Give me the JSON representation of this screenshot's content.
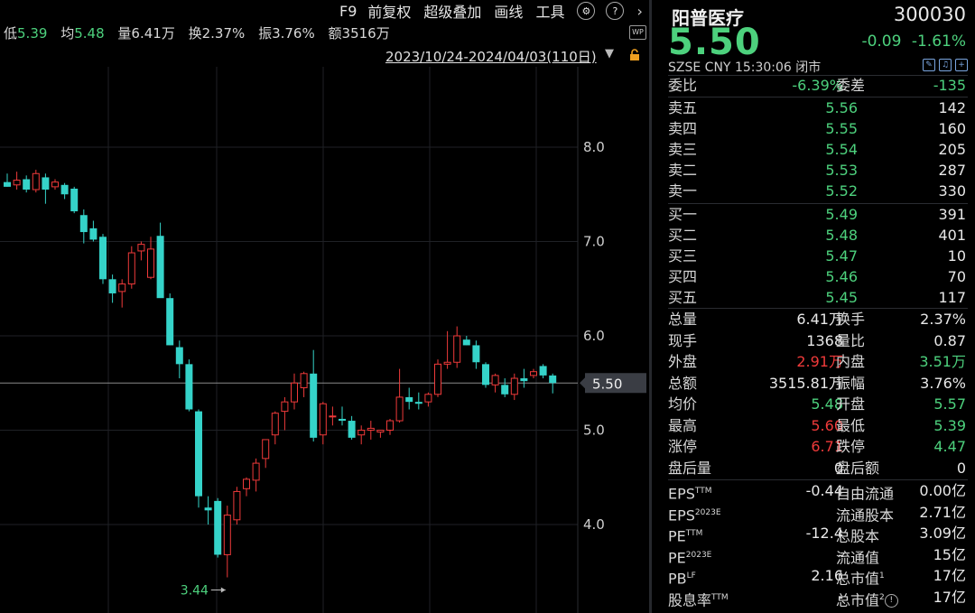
{
  "toolbar": {
    "f9": "F9",
    "restore": "前复权",
    "overlay": "超级叠加",
    "draw": "画线",
    "tools": "工具",
    "help": "?",
    "expand": "›"
  },
  "stats": {
    "low_label": "低",
    "low_value": "5.39",
    "avg_label": "均",
    "avg_value": "5.48",
    "vol_label": "量",
    "vol_value": "6.41万",
    "turn_label": "换",
    "turn_value": "2.37%",
    "amp_label": "振",
    "amp_value": "3.76%",
    "amt_label": "额",
    "amt_value": "3516万"
  },
  "wp_badge": "WP",
  "date_range": "2023/10/24-2024/04/03(110日)",
  "chart_data": {
    "type": "candlestick",
    "y_ticks": [
      "8.0",
      "7.0",
      "6.0",
      "5.0",
      "4.0"
    ],
    "current_price_label": "5.50",
    "min_label": "3.44",
    "ylim": [
      3.4,
      8.0
    ],
    "colors": {
      "up": "#ef3a3a",
      "down": "#35d3c9"
    },
    "candles": [
      {
        "o": 7.63,
        "h": 7.72,
        "l": 7.58,
        "c": 7.58
      },
      {
        "o": 7.6,
        "h": 7.74,
        "l": 7.55,
        "c": 7.65
      },
      {
        "o": 7.66,
        "h": 7.7,
        "l": 7.52,
        "c": 7.55
      },
      {
        "o": 7.55,
        "h": 7.76,
        "l": 7.52,
        "c": 7.72
      },
      {
        "o": 7.68,
        "h": 7.72,
        "l": 7.4,
        "c": 7.55
      },
      {
        "o": 7.58,
        "h": 7.66,
        "l": 7.55,
        "c": 7.63
      },
      {
        "o": 7.6,
        "h": 7.62,
        "l": 7.45,
        "c": 7.5
      },
      {
        "o": 7.56,
        "h": 7.58,
        "l": 7.3,
        "c": 7.32
      },
      {
        "o": 7.28,
        "h": 7.34,
        "l": 6.98,
        "c": 7.1
      },
      {
        "o": 7.14,
        "h": 7.22,
        "l": 7.0,
        "c": 7.02
      },
      {
        "o": 7.05,
        "h": 7.08,
        "l": 6.55,
        "c": 6.6
      },
      {
        "o": 6.6,
        "h": 6.65,
        "l": 6.35,
        "c": 6.45
      },
      {
        "o": 6.47,
        "h": 6.6,
        "l": 6.3,
        "c": 6.55
      },
      {
        "o": 6.55,
        "h": 6.95,
        "l": 6.5,
        "c": 6.88
      },
      {
        "o": 6.9,
        "h": 7.0,
        "l": 6.8,
        "c": 6.97
      },
      {
        "o": 6.62,
        "h": 7.05,
        "l": 6.6,
        "c": 6.92
      },
      {
        "o": 7.06,
        "h": 7.2,
        "l": 6.45,
        "c": 6.4
      },
      {
        "o": 6.4,
        "h": 6.45,
        "l": 5.9,
        "c": 5.9
      },
      {
        "o": 5.88,
        "h": 5.95,
        "l": 5.55,
        "c": 5.7
      },
      {
        "o": 5.7,
        "h": 5.75,
        "l": 5.2,
        "c": 5.22
      },
      {
        "o": 5.2,
        "h": 5.22,
        "l": 4.18,
        "c": 4.3
      },
      {
        "o": 4.18,
        "h": 4.3,
        "l": 4.0,
        "c": 4.15
      },
      {
        "o": 4.25,
        "h": 4.28,
        "l": 3.65,
        "c": 3.68
      },
      {
        "o": 3.68,
        "h": 4.2,
        "l": 3.44,
        "c": 4.1
      },
      {
        "o": 4.05,
        "h": 4.4,
        "l": 4.0,
        "c": 4.35
      },
      {
        "o": 4.38,
        "h": 4.5,
        "l": 4.3,
        "c": 4.48
      },
      {
        "o": 4.47,
        "h": 4.7,
        "l": 4.35,
        "c": 4.65
      },
      {
        "o": 4.7,
        "h": 4.9,
        "l": 4.6,
        "c": 4.9
      },
      {
        "o": 4.95,
        "h": 5.2,
        "l": 4.85,
        "c": 5.18
      },
      {
        "o": 5.2,
        "h": 5.35,
        "l": 5.0,
        "c": 5.3
      },
      {
        "o": 5.3,
        "h": 5.6,
        "l": 5.22,
        "c": 5.5
      },
      {
        "o": 5.45,
        "h": 5.62,
        "l": 5.35,
        "c": 5.6
      },
      {
        "o": 5.6,
        "h": 5.85,
        "l": 4.88,
        "c": 4.92
      },
      {
        "o": 4.95,
        "h": 5.3,
        "l": 4.85,
        "c": 5.28
      },
      {
        "o": 5.15,
        "h": 5.25,
        "l": 5.05,
        "c": 5.15
      },
      {
        "o": 5.12,
        "h": 5.25,
        "l": 5.05,
        "c": 5.1
      },
      {
        "o": 5.1,
        "h": 5.15,
        "l": 4.9,
        "c": 4.92
      },
      {
        "o": 4.95,
        "h": 5.05,
        "l": 4.85,
        "c": 5.0
      },
      {
        "o": 5.0,
        "h": 5.1,
        "l": 4.9,
        "c": 5.02
      },
      {
        "o": 4.98,
        "h": 5.0,
        "l": 4.92,
        "c": 5.0
      },
      {
        "o": 5.0,
        "h": 5.12,
        "l": 4.95,
        "c": 5.1
      },
      {
        "o": 5.1,
        "h": 5.65,
        "l": 5.08,
        "c": 5.35
      },
      {
        "o": 5.35,
        "h": 5.45,
        "l": 5.22,
        "c": 5.3
      },
      {
        "o": 5.3,
        "h": 5.4,
        "l": 5.22,
        "c": 5.28
      },
      {
        "o": 5.3,
        "h": 5.4,
        "l": 5.25,
        "c": 5.38
      },
      {
        "o": 5.38,
        "h": 5.75,
        "l": 5.35,
        "c": 5.7
      },
      {
        "o": 5.7,
        "h": 6.05,
        "l": 5.65,
        "c": 5.72
      },
      {
        "o": 5.72,
        "h": 6.1,
        "l": 5.66,
        "c": 6.0
      },
      {
        "o": 5.96,
        "h": 6.0,
        "l": 5.9,
        "c": 5.9
      },
      {
        "o": 5.9,
        "h": 5.95,
        "l": 5.65,
        "c": 5.72
      },
      {
        "o": 5.7,
        "h": 5.72,
        "l": 5.45,
        "c": 5.48
      },
      {
        "o": 5.48,
        "h": 5.6,
        "l": 5.4,
        "c": 5.58
      },
      {
        "o": 5.48,
        "h": 5.55,
        "l": 5.35,
        "c": 5.38
      },
      {
        "o": 5.38,
        "h": 5.6,
        "l": 5.32,
        "c": 5.55
      },
      {
        "o": 5.55,
        "h": 5.65,
        "l": 5.45,
        "c": 5.52
      },
      {
        "o": 5.58,
        "h": 5.65,
        "l": 5.55,
        "c": 5.62
      },
      {
        "o": 5.68,
        "h": 5.7,
        "l": 5.55,
        "c": 5.58
      },
      {
        "o": 5.58,
        "h": 5.6,
        "l": 5.39,
        "c": 5.5
      }
    ]
  },
  "quote": {
    "name": "阳普医疗",
    "code": "300030",
    "price": "5.50",
    "change": "-0.09",
    "change_pct": "-1.61%",
    "market": "SZSE",
    "currency": "CNY",
    "time": "15:30:06",
    "status": "闭市"
  },
  "order_ratio": {
    "label": "委比",
    "value": "-6.39%",
    "diff_label": "委差",
    "diff_value": "-135"
  },
  "asks": [
    {
      "label": "卖五",
      "price": "5.56",
      "vol": "142"
    },
    {
      "label": "卖四",
      "price": "5.55",
      "vol": "160"
    },
    {
      "label": "卖三",
      "price": "5.54",
      "vol": "205"
    },
    {
      "label": "卖二",
      "price": "5.53",
      "vol": "287"
    },
    {
      "label": "卖一",
      "price": "5.52",
      "vol": "330"
    }
  ],
  "bids": [
    {
      "label": "买一",
      "price": "5.49",
      "vol": "391"
    },
    {
      "label": "买二",
      "price": "5.48",
      "vol": "401"
    },
    {
      "label": "买三",
      "price": "5.47",
      "vol": "10"
    },
    {
      "label": "买四",
      "price": "5.46",
      "vol": "70"
    },
    {
      "label": "买五",
      "price": "5.45",
      "vol": "117"
    }
  ],
  "details": [
    {
      "l1": "总量",
      "v1": "6.41万",
      "c1": "white",
      "l2": "换手",
      "v2": "2.37%",
      "c2": "white"
    },
    {
      "l1": "现手",
      "v1": "1368",
      "c1": "white",
      "l2": "量比",
      "v2": "0.87",
      "c2": "white"
    },
    {
      "l1": "外盘",
      "v1": "2.91万",
      "c1": "red",
      "l2": "内盘",
      "v2": "3.51万",
      "c2": "green"
    },
    {
      "l1": "总额",
      "v1": "3515.81万",
      "c1": "white",
      "l2": "振幅",
      "v2": "3.76%",
      "c2": "white"
    },
    {
      "l1": "均价",
      "v1": "5.48",
      "c1": "green",
      "l2": "开盘",
      "v2": "5.57",
      "c2": "green"
    },
    {
      "l1": "最高",
      "v1": "5.60",
      "c1": "red",
      "l2": "最低",
      "v2": "5.39",
      "c2": "green"
    },
    {
      "l1": "涨停",
      "v1": "6.71",
      "c1": "red",
      "l2": "跌停",
      "v2": "4.47",
      "c2": "green"
    },
    {
      "l1": "盘后量",
      "v1": "0",
      "c1": "white",
      "l2": "盘后额",
      "v2": "0",
      "c2": "white"
    }
  ],
  "fundamentals": [
    {
      "l1": "EPS",
      "s1": "TTM",
      "v1": "-0.44",
      "l2": "自由流通",
      "s2": "",
      "v2": "0.00亿"
    },
    {
      "l1": "EPS",
      "s1": "2023E",
      "v1": "",
      "l2": "流通股本",
      "s2": "",
      "v2": "2.71亿"
    },
    {
      "l1": "PE",
      "s1": "TTM",
      "v1": "-12.4",
      "l2": "总股本",
      "s2": "",
      "v2": "3.09亿"
    },
    {
      "l1": "PE",
      "s1": "2023E",
      "v1": "-",
      "l2": "流通值",
      "s2": "",
      "v2": "15亿"
    },
    {
      "l1": "PB",
      "s1": "LF",
      "v1": "2.16",
      "l2": "总市值",
      "s2": "1",
      "v2": "17亿"
    },
    {
      "l1": "股息率",
      "s1": "TTM",
      "v1": "-",
      "l2": "总市值",
      "s2": "2",
      "v2": "17亿"
    }
  ]
}
